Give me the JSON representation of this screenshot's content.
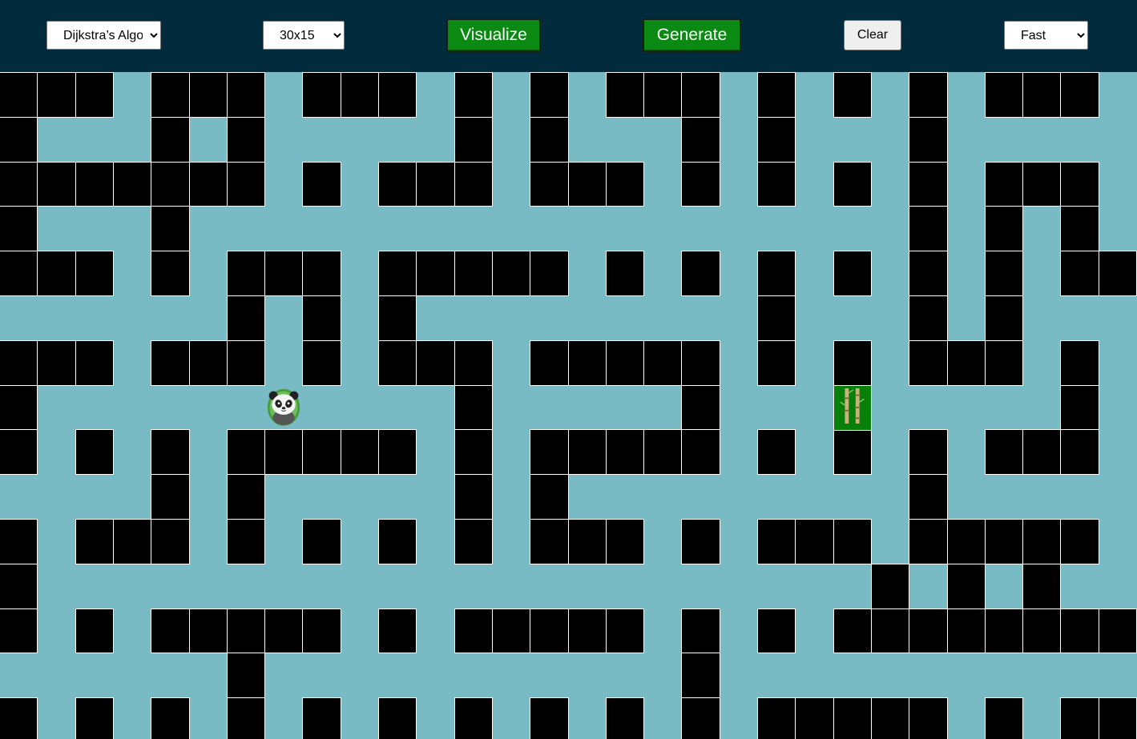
{
  "toolbar": {
    "algorithm": {
      "selected": "Dijkstra’s Algorithm",
      "options": [
        "Dijkstra’s Algorithm"
      ]
    },
    "size": {
      "selected": "30x15",
      "options": [
        "30x15"
      ]
    },
    "visualize_label": "Visualize",
    "generate_label": "Generate",
    "clear_label": "Clear",
    "speed": {
      "selected": "Fast",
      "options": [
        "Fast"
      ]
    }
  },
  "colors": {
    "toolbar_bg": "#032b3e",
    "open_cell": "#79bbc4",
    "wall": "#000000",
    "target": "#07800a",
    "button_green": "#0a8a12"
  },
  "grid": {
    "columns": 30,
    "rows": 15,
    "visible_rows": 15,
    "start": {
      "row": 7,
      "col": 7,
      "icon": "panda-icon"
    },
    "target": {
      "row": 7,
      "col": 22,
      "icon": "bamboo-icon"
    },
    "walls": [
      "WWW.WWW.WWW.W.W.WWW.W.W.W.WWW.",
      "W...W.W.....W.W...W.W...W.....",
      "WWWWWWW.W.WWW.WWW.W.W.W.W.WWW.",
      "W...W...................W.W.W.",
      "WWW.W.WWW.WWWWW.W.W.W.W.W.W.WW",
      "......W.W.W.........W...W.W...",
      "WWW.WWW.W.WWW.WWWWW.W.W.WWW.W.",
      "W...........W.....W.........W.",
      "W.W.W.WWWWW.W.WWWWW.W.W.W.WWW.",
      "....W.W.....W.W.........W.....",
      "W.WWW.W.W.W.W.WWW.W.WWW.WWWWW.",
      "W......................W.W.W..",
      "W.W.WWWWW.W.WWWWW.W.W.WWWWWWWW",
      "......W...........W...........",
      "W.W.W.W.W.W.W.W.W.W.WWWWW.W.WW"
    ]
  }
}
